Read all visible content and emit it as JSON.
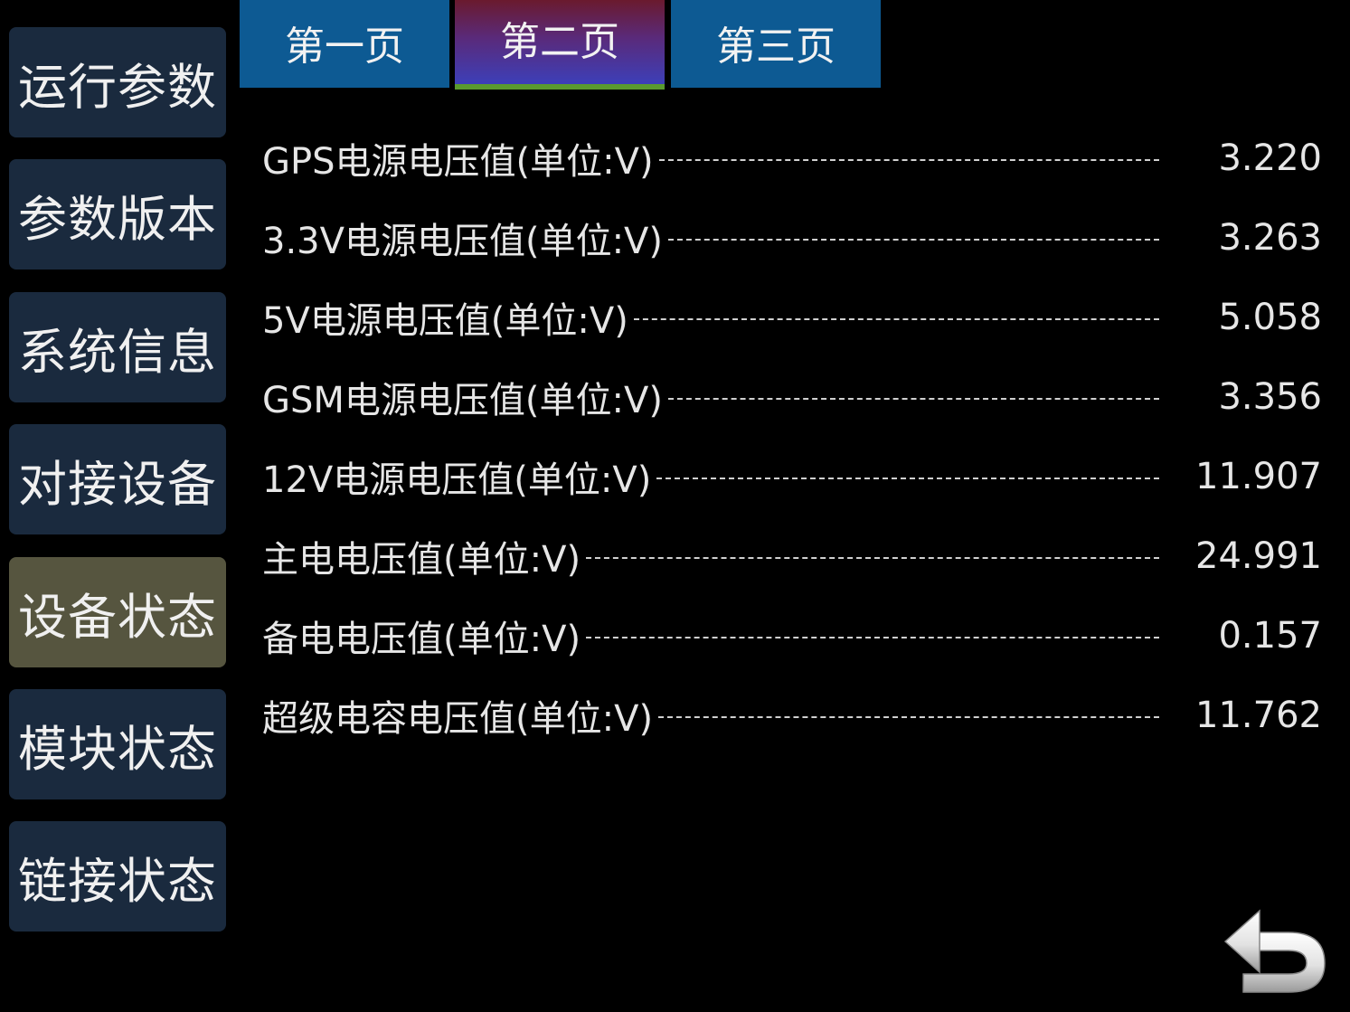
{
  "sidebar": {
    "items": [
      {
        "label": "运行参数"
      },
      {
        "label": "参数版本"
      },
      {
        "label": "系统信息"
      },
      {
        "label": "对接设备"
      },
      {
        "label": "设备状态"
      },
      {
        "label": "模块状态"
      },
      {
        "label": "链接状态"
      }
    ],
    "active_index": 4
  },
  "tabs": [
    {
      "label": "第一页"
    },
    {
      "label": "第二页"
    },
    {
      "label": "第三页"
    }
  ],
  "active_tab_index": 1,
  "rows": [
    {
      "label": "GPS电源电压值(单位:V)",
      "value": "3.220"
    },
    {
      "label": "3.3V电源电压值(单位:V)",
      "value": "3.263"
    },
    {
      "label": "5V电源电压值(单位:V)",
      "value": "5.058"
    },
    {
      "label": "GSM电源电压值(单位:V)",
      "value": "3.356"
    },
    {
      "label": "12V电源电压值(单位:V)",
      "value": "11.907"
    },
    {
      "label": "主电电压值(单位:V)",
      "value": "24.991"
    },
    {
      "label": "备电电压值(单位:V)",
      "value": "0.157"
    },
    {
      "label": "超级电容电压值(单位:V)",
      "value": "11.762"
    }
  ],
  "icons": {
    "back": "back-arrow-icon"
  },
  "colors": {
    "background": "#000000",
    "sidebar_item": "#1a2a3e",
    "sidebar_active": "#56553f",
    "tab": "#0d5a93",
    "tab_active_accent": "#5a9a2e"
  }
}
